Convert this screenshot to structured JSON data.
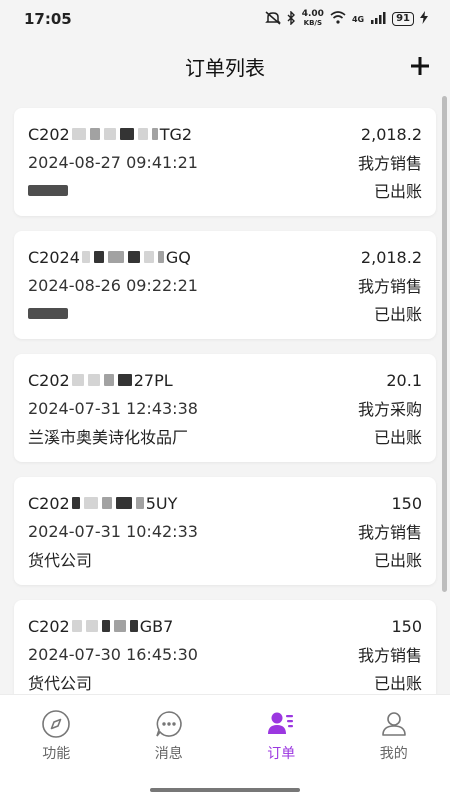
{
  "status_bar": {
    "time": "17:05",
    "network_speed_value": "4.00",
    "network_speed_unit": "KB/S",
    "network_type": "4G",
    "battery": "91"
  },
  "header": {
    "title": "订单列表",
    "add_icon": "plus-icon"
  },
  "orders": [
    {
      "order_no_prefix": "C202",
      "order_no_suffix": "TG2",
      "datetime": "2024-08-27 09:41:21",
      "amount": "2,018.2",
      "type": "我方销售",
      "counterparty": "",
      "status": "已出账"
    },
    {
      "order_no_prefix": "C2024",
      "order_no_suffix": "GQ",
      "datetime": "2024-08-26 09:22:21",
      "amount": "2,018.2",
      "type": "我方销售",
      "counterparty": "",
      "status": "已出账"
    },
    {
      "order_no_prefix": "C202",
      "order_no_suffix": "27PL",
      "datetime": "2024-07-31 12:43:38",
      "amount": "20.1",
      "type": "我方采购",
      "counterparty": "兰溪市奥美诗化妆品厂",
      "status": "已出账"
    },
    {
      "order_no_prefix": "C202",
      "order_no_suffix": "5UY",
      "datetime": "2024-07-31 10:42:33",
      "amount": "150",
      "type": "我方销售",
      "counterparty": "货代公司",
      "status": "已出账"
    },
    {
      "order_no_prefix": "C202",
      "order_no_suffix": "GB7",
      "datetime": "2024-07-30 16:45:30",
      "amount": "150",
      "type": "我方销售",
      "counterparty": "货代公司",
      "status": "已出账"
    }
  ],
  "tabs": [
    {
      "label": "功能",
      "icon": "compass-icon",
      "active": false
    },
    {
      "label": "消息",
      "icon": "chat-icon",
      "active": false
    },
    {
      "label": "订单",
      "icon": "order-user-icon",
      "active": true
    },
    {
      "label": "我的",
      "icon": "profile-icon",
      "active": false
    }
  ],
  "colors": {
    "accent": "#9b37e0",
    "background": "#f4f4f4",
    "card": "#ffffff",
    "tab_inactive": "#666666"
  }
}
